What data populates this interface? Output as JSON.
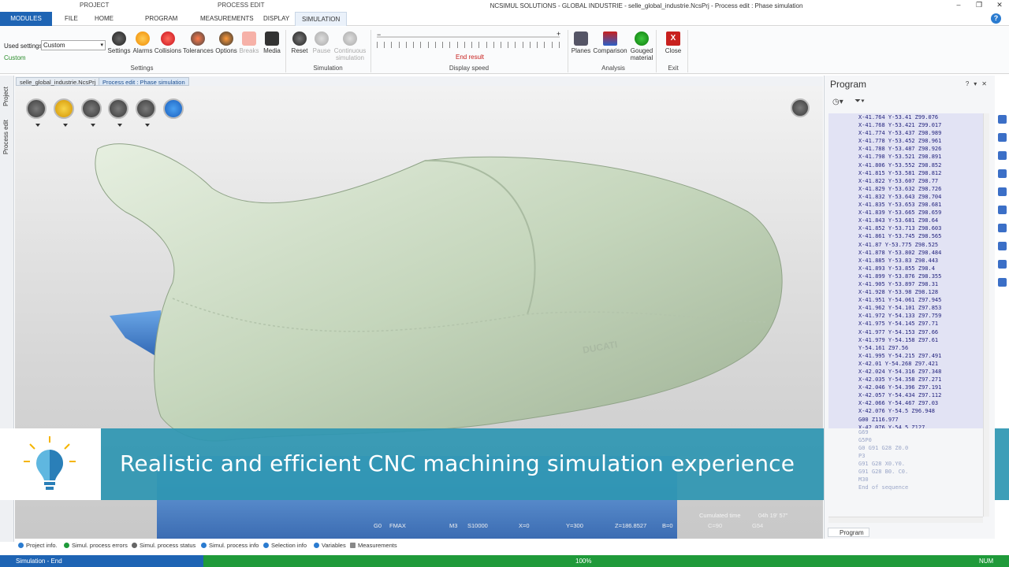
{
  "titlebar": {
    "context_project": "PROJECT",
    "context_process_edit": "PROCESS EDIT",
    "title": "NCSIMUL SOLUTIONS - GLOBAL INDUSTRIE - selle_global_industrie.NcsPrj - Process edit : Phase simulation"
  },
  "tabs": {
    "modules": "MODULES",
    "file": "FILE",
    "home": "HOME",
    "program": "PROGRAM",
    "measurements": "MEASUREMENTS",
    "display": "DISPLAY",
    "simulation": "SIMULATION"
  },
  "ribbon": {
    "used_settings_label": "Used settings",
    "used_settings_value": "Custom",
    "custom_label": "Custom",
    "settings_group": "Settings",
    "simulation_group": "Simulation",
    "display_speed_group": "Display speed",
    "analysis_group": "Analysis",
    "exit_group": "Exit",
    "buttons": {
      "settings": "Settings",
      "alarms": "Alarms",
      "collisions": "Collisions",
      "tolerances": "Tolerances",
      "options": "Options",
      "breaks": "Breaks",
      "media": "Media",
      "reset": "Reset",
      "pause": "Pause",
      "continuous_1": "Continuous",
      "continuous_2": "simulation",
      "planes": "Planes",
      "comparison": "Comparison",
      "gouged_1": "Gouged",
      "gouged_2": "material",
      "close": "Close"
    },
    "end_result": "End result",
    "speed_minus": "−",
    "speed_plus": "+"
  },
  "left_panel": {
    "project_tab": "Project",
    "process_edit_tab": "Process edit"
  },
  "doc_tabs": {
    "project_file": "selle_global_industrie.NcsPrj",
    "process_edit": "Process edit : Phase simulation"
  },
  "viewport": {
    "logo_text": "DUCATI",
    "cumulated_time_label": "Cumulated time",
    "cumulated_time_value": "04h 19' 57\"",
    "status": {
      "g0": "G0",
      "fmax": "FMAX",
      "m3": "M3",
      "s": "S10000",
      "x": "X=0",
      "y": "Y=300",
      "z": "Z=186.8527",
      "b": "B=0",
      "c": "C=90",
      "g54": "G54"
    }
  },
  "banner": {
    "caption": "Realistic and efficient CNC machining simulation experience"
  },
  "program_panel": {
    "title": "Program",
    "lines": [
      "X-41.764 Y-53.41 Z99.076",
      "X-41.768 Y-53.421 Z99.017",
      "X-41.774 Y-53.437 Z98.989",
      "X-41.778 Y-53.452 Z98.961",
      "X-41.788 Y-53.487 Z98.926",
      "X-41.798 Y-53.521 Z98.891",
      "X-41.806 Y-53.552 Z98.852",
      "X-41.815 Y-53.581 Z98.812",
      "X-41.822 Y-53.607 Z98.77",
      "X-41.829 Y-53.632 Z98.726",
      "X-41.832 Y-53.643 Z98.704",
      "X-41.835 Y-53.653 Z98.681",
      "X-41.839 Y-53.665 Z98.659",
      "X-41.843 Y-53.681 Z98.64",
      "X-41.852 Y-53.713 Z98.603",
      "X-41.861 Y-53.745 Z98.565",
      "X-41.87 Y-53.775 Z98.525",
      "X-41.878 Y-53.802 Z98.484",
      "X-41.885 Y-53.83 Z98.443",
      "X-41.893 Y-53.855 Z98.4",
      "X-41.899 Y-53.876 Z98.355",
      "X-41.905 Y-53.897 Z98.31",
      "X-41.928 Y-53.98 Z98.128",
      "X-41.951 Y-54.061 Z97.945",
      "X-41.962 Y-54.101 Z97.853",
      "X-41.972 Y-54.133 Z97.759",
      "X-41.975 Y-54.145 Z97.71",
      "X-41.977 Y-54.153 Z97.66",
      "X-41.979 Y-54.158 Z97.61",
      "Y-54.161 Z97.56",
      "X-41.995 Y-54.215 Z97.491",
      "X-42.01 Y-54.268 Z97.421",
      "X-42.024 Y-54.316 Z97.348",
      "X-42.035 Y-54.358 Z97.271",
      "X-42.046 Y-54.396 Z97.191",
      "X-42.057 Y-54.434 Z97.112",
      "X-42.066 Y-54.467 Z97.03",
      "X-42.076 Y-54.5 Z96.948",
      "G00 Z116.977",
      "X-42.076 Y-54.5 Z127."
    ],
    "faded_lines": [
      "G69",
      "G5P0",
      "G0 G91 G28 Z0.0",
      "P3",
      "G91 G28 X0.Y0.",
      "G91 G28 B0. C0.",
      "M30",
      "End of sequence"
    ],
    "tab_label": "Program"
  },
  "bottom_tabs": {
    "project_info": "Project info.",
    "simul_errors": "Simul. process errors",
    "simul_status": "Simul. process status",
    "simul_info": "Simul. process info",
    "selection_info": "Selection info",
    "variables": "Variables",
    "measurements": "Measurements"
  },
  "statusbar": {
    "left": "Simulation - End",
    "percent": "100%",
    "num": "NUM"
  },
  "colors": {
    "accent_blue": "#1e64b4",
    "status_green": "#1f9a3a",
    "banner_teal": "#2e96b2",
    "program_text": "#23237d"
  }
}
